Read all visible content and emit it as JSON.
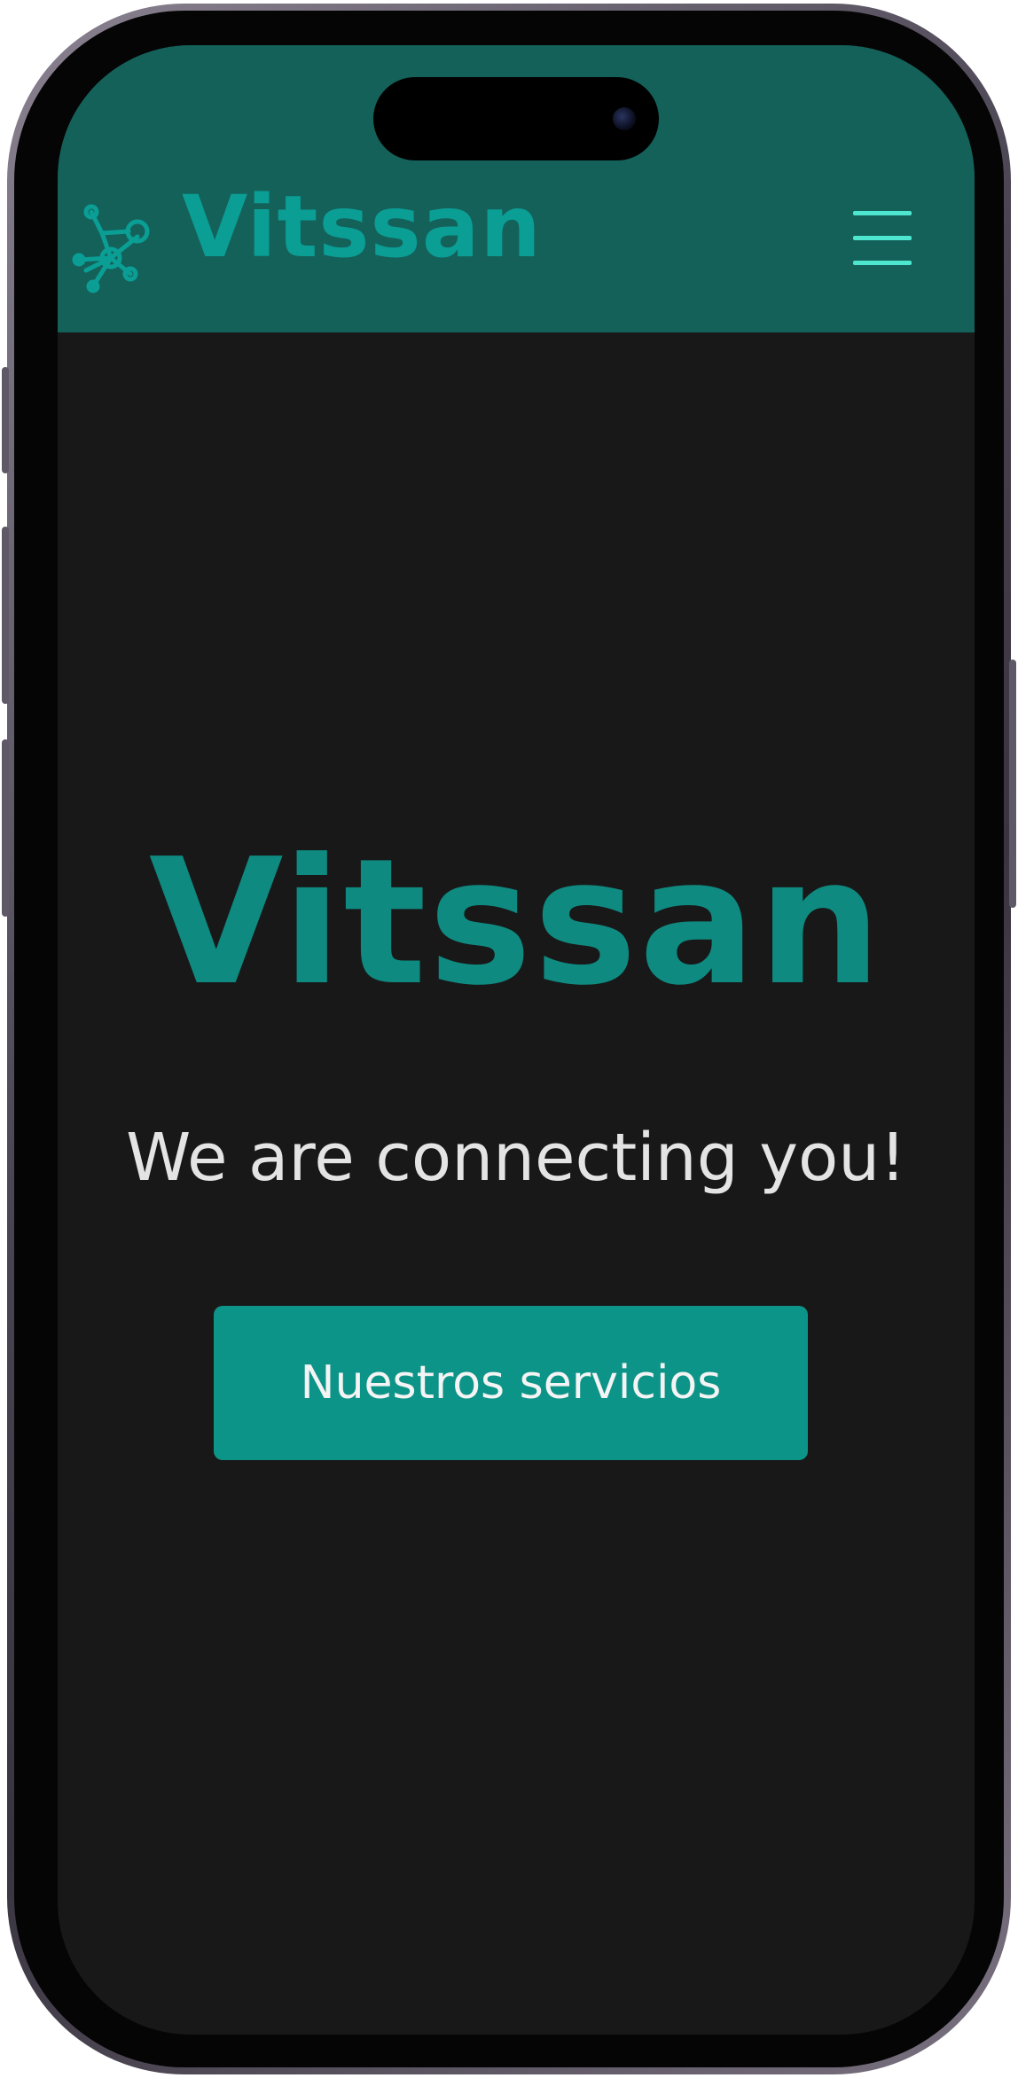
{
  "navbar": {
    "brand_name": "Vitssan",
    "logo_icon": "network-nodes-icon",
    "menu_icon": "hamburger-menu-icon",
    "background_color": "#14615a",
    "brand_color": "#0a9e95",
    "menu_color": "#4fe6cf"
  },
  "hero": {
    "title": "Vitssan",
    "subtitle": "We are connecting you!",
    "cta_label": "Nuestros servicios",
    "title_color": "#0e8a80",
    "button_color": "#0d9488",
    "background_color": "#181818"
  }
}
